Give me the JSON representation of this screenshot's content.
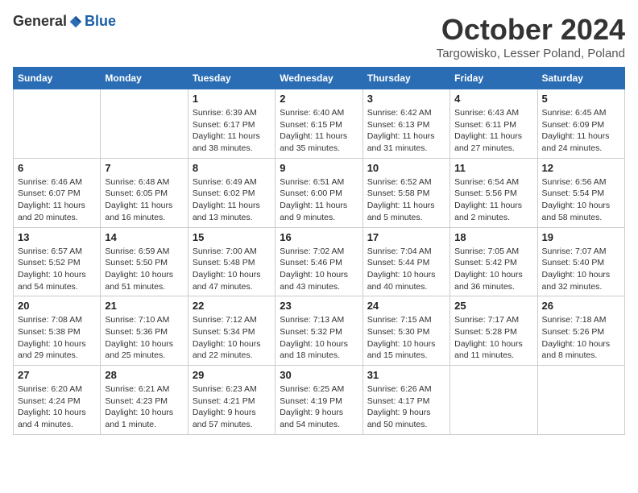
{
  "header": {
    "logo": {
      "general": "General",
      "blue": "Blue"
    },
    "title": "October 2024",
    "location": "Targowisko, Lesser Poland, Poland"
  },
  "weekdays": [
    "Sunday",
    "Monday",
    "Tuesday",
    "Wednesday",
    "Thursday",
    "Friday",
    "Saturday"
  ],
  "weeks": [
    [
      {
        "day": "",
        "info": ""
      },
      {
        "day": "",
        "info": ""
      },
      {
        "day": "1",
        "info": "Sunrise: 6:39 AM\nSunset: 6:17 PM\nDaylight: 11 hours and 38 minutes."
      },
      {
        "day": "2",
        "info": "Sunrise: 6:40 AM\nSunset: 6:15 PM\nDaylight: 11 hours and 35 minutes."
      },
      {
        "day": "3",
        "info": "Sunrise: 6:42 AM\nSunset: 6:13 PM\nDaylight: 11 hours and 31 minutes."
      },
      {
        "day": "4",
        "info": "Sunrise: 6:43 AM\nSunset: 6:11 PM\nDaylight: 11 hours and 27 minutes."
      },
      {
        "day": "5",
        "info": "Sunrise: 6:45 AM\nSunset: 6:09 PM\nDaylight: 11 hours and 24 minutes."
      }
    ],
    [
      {
        "day": "6",
        "info": "Sunrise: 6:46 AM\nSunset: 6:07 PM\nDaylight: 11 hours and 20 minutes."
      },
      {
        "day": "7",
        "info": "Sunrise: 6:48 AM\nSunset: 6:05 PM\nDaylight: 11 hours and 16 minutes."
      },
      {
        "day": "8",
        "info": "Sunrise: 6:49 AM\nSunset: 6:02 PM\nDaylight: 11 hours and 13 minutes."
      },
      {
        "day": "9",
        "info": "Sunrise: 6:51 AM\nSunset: 6:00 PM\nDaylight: 11 hours and 9 minutes."
      },
      {
        "day": "10",
        "info": "Sunrise: 6:52 AM\nSunset: 5:58 PM\nDaylight: 11 hours and 5 minutes."
      },
      {
        "day": "11",
        "info": "Sunrise: 6:54 AM\nSunset: 5:56 PM\nDaylight: 11 hours and 2 minutes."
      },
      {
        "day": "12",
        "info": "Sunrise: 6:56 AM\nSunset: 5:54 PM\nDaylight: 10 hours and 58 minutes."
      }
    ],
    [
      {
        "day": "13",
        "info": "Sunrise: 6:57 AM\nSunset: 5:52 PM\nDaylight: 10 hours and 54 minutes."
      },
      {
        "day": "14",
        "info": "Sunrise: 6:59 AM\nSunset: 5:50 PM\nDaylight: 10 hours and 51 minutes."
      },
      {
        "day": "15",
        "info": "Sunrise: 7:00 AM\nSunset: 5:48 PM\nDaylight: 10 hours and 47 minutes."
      },
      {
        "day": "16",
        "info": "Sunrise: 7:02 AM\nSunset: 5:46 PM\nDaylight: 10 hours and 43 minutes."
      },
      {
        "day": "17",
        "info": "Sunrise: 7:04 AM\nSunset: 5:44 PM\nDaylight: 10 hours and 40 minutes."
      },
      {
        "day": "18",
        "info": "Sunrise: 7:05 AM\nSunset: 5:42 PM\nDaylight: 10 hours and 36 minutes."
      },
      {
        "day": "19",
        "info": "Sunrise: 7:07 AM\nSunset: 5:40 PM\nDaylight: 10 hours and 32 minutes."
      }
    ],
    [
      {
        "day": "20",
        "info": "Sunrise: 7:08 AM\nSunset: 5:38 PM\nDaylight: 10 hours and 29 minutes."
      },
      {
        "day": "21",
        "info": "Sunrise: 7:10 AM\nSunset: 5:36 PM\nDaylight: 10 hours and 25 minutes."
      },
      {
        "day": "22",
        "info": "Sunrise: 7:12 AM\nSunset: 5:34 PM\nDaylight: 10 hours and 22 minutes."
      },
      {
        "day": "23",
        "info": "Sunrise: 7:13 AM\nSunset: 5:32 PM\nDaylight: 10 hours and 18 minutes."
      },
      {
        "day": "24",
        "info": "Sunrise: 7:15 AM\nSunset: 5:30 PM\nDaylight: 10 hours and 15 minutes."
      },
      {
        "day": "25",
        "info": "Sunrise: 7:17 AM\nSunset: 5:28 PM\nDaylight: 10 hours and 11 minutes."
      },
      {
        "day": "26",
        "info": "Sunrise: 7:18 AM\nSunset: 5:26 PM\nDaylight: 10 hours and 8 minutes."
      }
    ],
    [
      {
        "day": "27",
        "info": "Sunrise: 6:20 AM\nSunset: 4:24 PM\nDaylight: 10 hours and 4 minutes."
      },
      {
        "day": "28",
        "info": "Sunrise: 6:21 AM\nSunset: 4:23 PM\nDaylight: 10 hours and 1 minute."
      },
      {
        "day": "29",
        "info": "Sunrise: 6:23 AM\nSunset: 4:21 PM\nDaylight: 9 hours and 57 minutes."
      },
      {
        "day": "30",
        "info": "Sunrise: 6:25 AM\nSunset: 4:19 PM\nDaylight: 9 hours and 54 minutes."
      },
      {
        "day": "31",
        "info": "Sunrise: 6:26 AM\nSunset: 4:17 PM\nDaylight: 9 hours and 50 minutes."
      },
      {
        "day": "",
        "info": ""
      },
      {
        "day": "",
        "info": ""
      }
    ]
  ]
}
